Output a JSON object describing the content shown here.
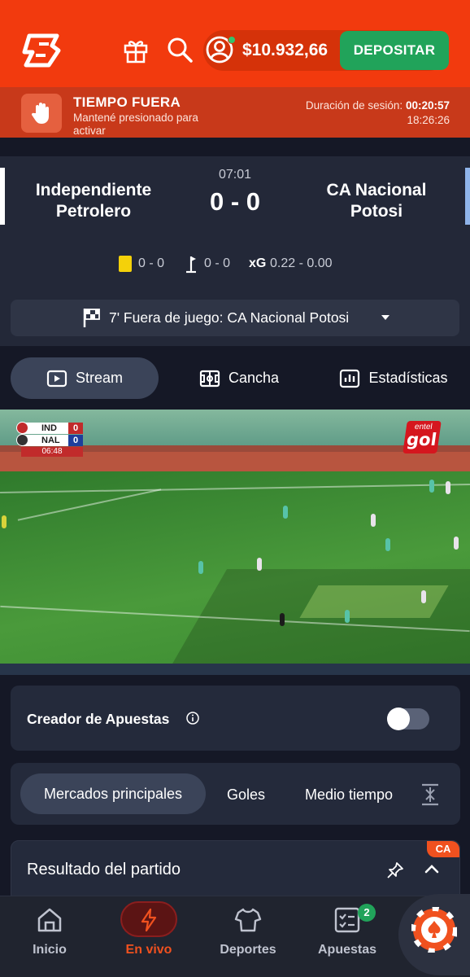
{
  "header": {
    "logo": "B",
    "balance": "$10.932,66",
    "deposit_label": "DEPOSITAR",
    "icons": [
      "gift-icon",
      "search-icon",
      "user-icon"
    ]
  },
  "timeout": {
    "title": "TIEMPO FUERA",
    "subtitle": "Mantené presionado para activar",
    "session_label": "Duración de sesión:",
    "session_value": "00:20:57",
    "clock": "18:26:26"
  },
  "match": {
    "home_team": "Independiente Petrolero",
    "away_team": "CA Nacional Potosi",
    "time": "07:01",
    "score": "0 - 0",
    "yellow_cards": "0 - 0",
    "corners": "0 - 0",
    "xg_label": "xG",
    "xg_value": "0.22 - 0.00",
    "event": "7'  Fuera de juego: CA Nacional Potosi"
  },
  "tabs": [
    {
      "label": "Stream"
    },
    {
      "label": "Cancha"
    },
    {
      "label": "Estadísticas"
    }
  ],
  "stream": {
    "home_abbr": "IND",
    "home_score": "0",
    "away_abbr": "NAL",
    "away_score": "0",
    "clock": "06:48",
    "broadcaster_top": "entel",
    "broadcaster_main": "gol"
  },
  "bet_builder": {
    "label": "Creador de Apuestas",
    "enabled": false
  },
  "markets": {
    "tabs": [
      "Mercados principales",
      "Goles",
      "Medio tiempo"
    ]
  },
  "result": {
    "title": "Resultado del partido",
    "badge": "CA"
  },
  "bottom_nav": [
    {
      "label": "Inicio"
    },
    {
      "label": "En vivo"
    },
    {
      "label": "Deportes"
    },
    {
      "label": "Apuestas",
      "badge": "2"
    }
  ],
  "colors": {
    "brand": "#f23a0e",
    "deposit": "#21a35a",
    "live": "#f0511f",
    "background": "#151826"
  }
}
